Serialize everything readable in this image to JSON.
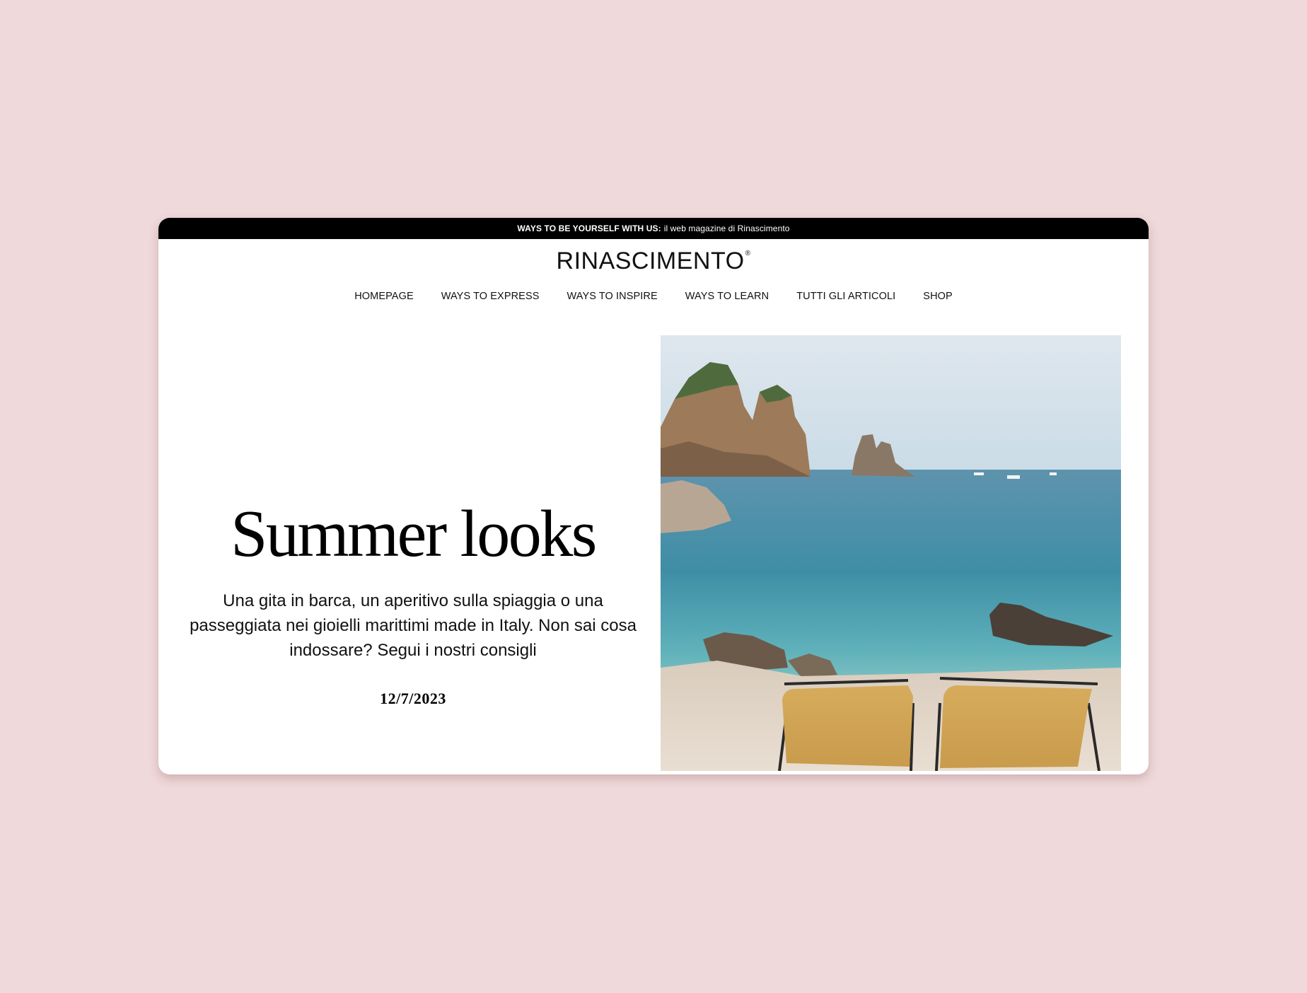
{
  "promo": {
    "strong": "WAYS TO BE YOURSELF WITH US:",
    "text": "il web magazine di Rinascimento"
  },
  "brand": {
    "logo": "RINASCIMENTO",
    "registered_mark": "®"
  },
  "nav": {
    "items": [
      "HOMEPAGE",
      "WAYS TO EXPRESS",
      "WAYS TO INSPIRE",
      "WAYS TO LEARN",
      "TUTTI GLI ARTICOLI",
      "SHOP"
    ]
  },
  "hero": {
    "title": "Summer looks",
    "subtitle": "Una gita in barca, un aperitivo sulla spiaggia o una passeggiata nei gioielli marittimi made in Italy. Non sai cosa indossare? Segui i nostri consigli",
    "date": "12/7/2023"
  },
  "colors": {
    "background": "#f0d9da",
    "promo_bar": "#000000",
    "text": "#111111"
  }
}
